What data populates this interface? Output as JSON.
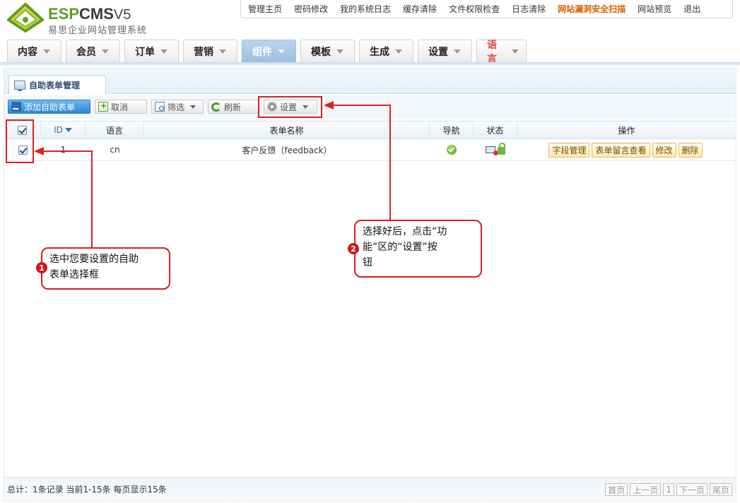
{
  "header": {
    "logo_brand_a": "ESP",
    "logo_brand_b": "CMS",
    "logo_version": "V5",
    "logo_subtitle": "易思企业网站管理系统",
    "topnav": [
      "管理主页",
      "密码修改",
      "我的系统日志",
      "缓存清除",
      "文件权限检查",
      "日志清除",
      "网站漏洞安全扫描",
      "网站预览",
      "退出"
    ]
  },
  "mainnav": {
    "tabs": [
      "内容",
      "会员",
      "订单",
      "营销",
      "组件",
      "模板",
      "生成",
      "设置",
      "语言"
    ],
    "active_tab": "组件"
  },
  "panel": {
    "tab_label": "自助表单管理"
  },
  "toolbar": {
    "add_label": "添加自助表单",
    "cancel_label": "取消",
    "filter_label": "筛选",
    "refresh_label": "刷新",
    "settings_label": "设置"
  },
  "table": {
    "columns": [
      "ID",
      "语言",
      "表单名称",
      "导航",
      "状态",
      "操作"
    ],
    "rows": [
      {
        "id": "1",
        "lang": "cn",
        "name": "客户反馈（feedback）",
        "nav": "ok-icon",
        "actions": [
          "字段管理",
          "表单留言查看",
          "修改",
          "删除"
        ]
      }
    ]
  },
  "footer": {
    "summary": "总计：1条记录 当前1-15条 每页显示15条",
    "pager": [
      "首页",
      "上一页",
      "1",
      "下一页",
      "尾页"
    ]
  },
  "annotations": {
    "one_num": "1",
    "one_line1": "选中您要设置的自助",
    "one_line2": "表单选择框",
    "two_num": "2",
    "two_line1": "选择好后，点击“功",
    "two_line2": "能”区的“设置”按",
    "two_line3": "钮"
  },
  "colors": {
    "annotation_red": "#e02020",
    "active_tab": "#9cbfe2",
    "brand_green": "#5aa023"
  }
}
